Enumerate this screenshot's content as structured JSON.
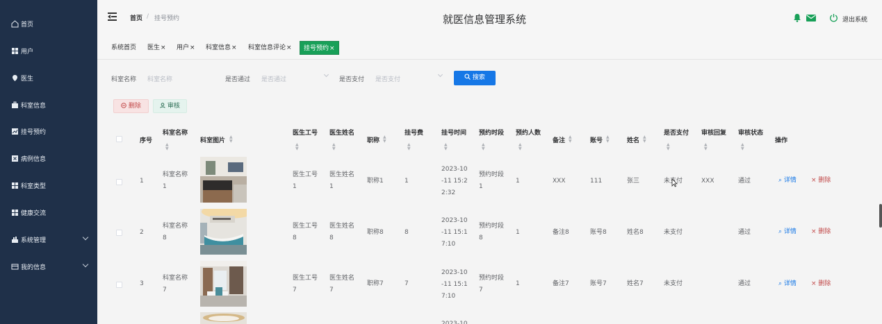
{
  "sidebar": {
    "items": [
      {
        "label": "首页",
        "icon": "home-icon"
      },
      {
        "label": "用户",
        "icon": "grid-icon"
      },
      {
        "label": "医生",
        "icon": "location-pin-icon"
      },
      {
        "label": "科室信息",
        "icon": "briefcase-icon"
      },
      {
        "label": "挂号预约",
        "icon": "chart-icon"
      },
      {
        "label": "病例信息",
        "icon": "delete-box-icon"
      },
      {
        "label": "科室类型",
        "icon": "grid-icon"
      },
      {
        "label": "健康交流",
        "icon": "grid-icon"
      },
      {
        "label": "系统管理",
        "icon": "settings-icon"
      },
      {
        "label": "我的信息",
        "icon": "id-card-icon"
      }
    ]
  },
  "header": {
    "breadcrumb_home": "首页",
    "breadcrumb_sep": "/",
    "breadcrumb_current": "挂号预约",
    "title": "就医信息管理系统",
    "logout": "退出系统"
  },
  "tabs": [
    {
      "label": "系统首页",
      "closable": false
    },
    {
      "label": "医生",
      "closable": true
    },
    {
      "label": "用户",
      "closable": true
    },
    {
      "label": "科室信息",
      "closable": true
    },
    {
      "label": "科室信息评论",
      "closable": true
    },
    {
      "label": "挂号预约",
      "closable": true,
      "active": true
    }
  ],
  "tab_close": "×",
  "search": {
    "dept_label": "科室名称",
    "dept_placeholder": "科室名称",
    "pass_label": "是否通过",
    "pass_placeholder": "是否通过",
    "paid_label": "是否支付",
    "paid_placeholder": "是否支付",
    "search_button": "搜索"
  },
  "actions": {
    "delete": "删除",
    "audit": "审核"
  },
  "table": {
    "headers": [
      "序号",
      "科室名称",
      "科室图片",
      "医生工号",
      "医生姓名",
      "职称",
      "挂号费",
      "挂号时间",
      "预约时段",
      "预约人数",
      "备注",
      "账号",
      "姓名",
      "是否支付",
      "审核回复",
      "审核状态",
      "操作"
    ],
    "detail_label": "详情",
    "delete_label": "删除",
    "rows": [
      {
        "no": "1",
        "dept": [
          "科室名称",
          "1"
        ],
        "doc_id": [
          "医生工号",
          "1"
        ],
        "doc_name": [
          "医生姓名",
          "1"
        ],
        "title": "职称1",
        "fee": "1",
        "time": [
          "2023-10",
          "-11 15:2",
          "2:32"
        ],
        "slot": [
          "预约时段",
          "1"
        ],
        "count": "1",
        "note": "XXX",
        "account": "111",
        "name": "张三",
        "paid": "未支付",
        "reply": "XXX",
        "status": "通过"
      },
      {
        "no": "2",
        "dept": [
          "科室名称",
          "8"
        ],
        "doc_id": [
          "医生工号",
          "8"
        ],
        "doc_name": [
          "医生姓名",
          "8"
        ],
        "title": "职称8",
        "fee": "8",
        "time": [
          "2023-10",
          "-11 15:1",
          "7:10"
        ],
        "slot": [
          "预约时段",
          "8"
        ],
        "count": "1",
        "note": "备注8",
        "account": "账号8",
        "name": "姓名8",
        "paid": "未支付",
        "reply": "",
        "status": "通过"
      },
      {
        "no": "3",
        "dept": [
          "科室名称",
          "7"
        ],
        "doc_id": [
          "医生工号",
          "7"
        ],
        "doc_name": [
          "医生姓名",
          "7"
        ],
        "title": "职称7",
        "fee": "7",
        "time": [
          "2023-10",
          "-11 15:1",
          "7:10"
        ],
        "slot": [
          "预约时段",
          "7"
        ],
        "count": "1",
        "note": "备注7",
        "account": "账号7",
        "name": "姓名7",
        "paid": "未支付",
        "reply": "",
        "status": "通过"
      },
      {
        "no": "",
        "dept": [
          "",
          ""
        ],
        "doc_id": [
          "",
          ""
        ],
        "doc_name": [
          "",
          ""
        ],
        "title": "",
        "fee": "",
        "time": [
          "2023-10",
          "",
          ""
        ],
        "slot": [
          "",
          ""
        ],
        "count": "",
        "note": "",
        "account": "",
        "name": "",
        "paid": "",
        "reply": "",
        "status": ""
      }
    ]
  },
  "colors": {
    "sidebar_bg": "#1f3049",
    "active_tab": "#18a058",
    "primary": "#1677e6",
    "danger": "#c24a4a",
    "bell": "#18a058",
    "mail": "#18a058"
  }
}
